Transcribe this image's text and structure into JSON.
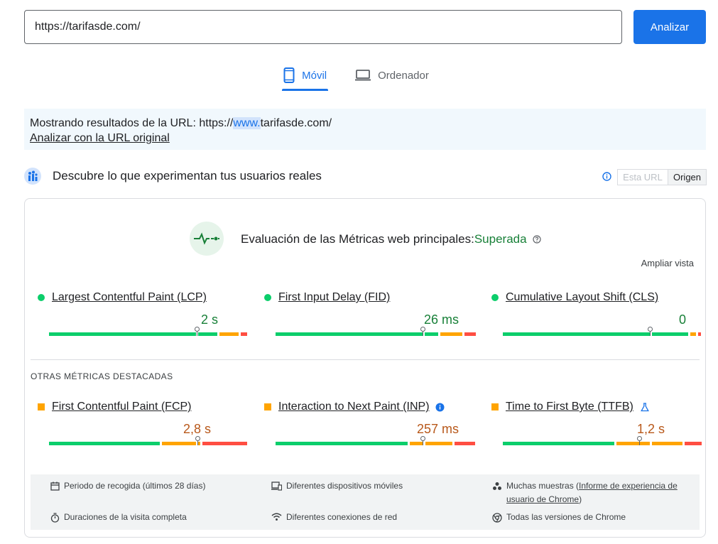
{
  "search": {
    "url_value": "https://tarifasde.com/",
    "analyze_label": "Analizar"
  },
  "tabs": [
    {
      "label": "Móvil",
      "active": true
    },
    {
      "label": "Ordenador",
      "active": false
    }
  ],
  "notice": {
    "prefix": "Mostrando resultados de la URL: https://",
    "highlight": "www.",
    "suffix": "tarifasde.com/",
    "link": "Analizar con la URL original"
  },
  "section": {
    "title": "Descubre lo que experimentan tus usuarios reales",
    "toggle": {
      "off": "Esta URL",
      "on": "Origen"
    }
  },
  "assessment": {
    "label": "Evaluación de las Métricas web principales:",
    "result": "Superada",
    "expand": "Ampliar vista"
  },
  "core_metrics": [
    {
      "name": "Largest Contentful Paint (LCP)",
      "value": "2 s",
      "status": "good"
    },
    {
      "name": "First Input Delay (FID)",
      "value": "26 ms",
      "status": "good"
    },
    {
      "name": "Cumulative Layout Shift (CLS)",
      "value": "0",
      "status": "good"
    }
  ],
  "other_title": "OTRAS MÉTRICAS DESTACADAS",
  "other_metrics": [
    {
      "name": "First Contentful Paint (FCP)",
      "value": "2,8 s",
      "status": "needs-improvement"
    },
    {
      "name": "Interaction to Next Paint (INP)",
      "value": "257 ms",
      "status": "needs-improvement"
    },
    {
      "name": "Time to First Byte (TTFB)",
      "value": "1,2 s",
      "status": "needs-improvement"
    }
  ],
  "footer": {
    "period": "Periodo de recogida (últimos 28 días)",
    "devices": "Diferentes dispositivos móviles",
    "samples_prefix": "Muchas muestras (",
    "samples_link": "Informe de experiencia de usuario de Chrome",
    "samples_suffix": ")",
    "durations": "Duraciones de la visita completa",
    "networks": "Diferentes conexiones de red",
    "versions": "Todas las versiones de Chrome"
  },
  "colors": {
    "accent": "#1a73e8",
    "good": "#0cce6b",
    "needs_improvement": "#ffa400",
    "poor": "#ff4e42",
    "pass_text": "#188038"
  }
}
